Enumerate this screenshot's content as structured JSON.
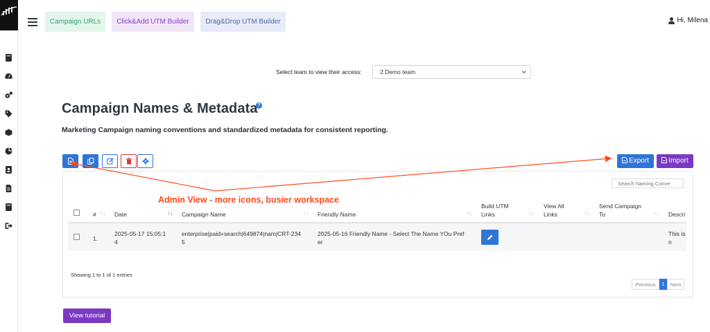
{
  "topbar": {
    "tabs": [
      {
        "label": "Campaign URLs"
      },
      {
        "label": "Click&Add UTM Builder"
      },
      {
        "label": "Drag&Drop UTM Builder"
      }
    ],
    "user_greeting": "Hi, Milena"
  },
  "sidebar": {
    "icons": [
      "book-icon",
      "dashboard-icon",
      "cogs-icon",
      "tag-icon",
      "cube-icon",
      "pie-chart-icon",
      "contact-icon",
      "file-icon",
      "book-icon",
      "logout-icon"
    ]
  },
  "team_select": {
    "label": "Select team to view their access:",
    "value": "2.Demo team"
  },
  "page": {
    "title": "Campaign Names & Metadata",
    "help": "?",
    "subtitle": "Marketing Campaign naming conventions and standardized metadata for consistent reporting."
  },
  "toolbar": {
    "export_label": "Export",
    "import_label": "Import"
  },
  "annotation": {
    "text": "Admin View - more icons, busier workspace",
    "color": "#ff4a1c"
  },
  "table": {
    "search_placeholder": "Search Naming Conve",
    "columns": {
      "num": "#",
      "date": "Date",
      "campaign_name": "Campaign Name",
      "friendly_name": "Friendly Name",
      "build_utm_1": "Build UTM",
      "build_utm_2": "Links",
      "view_all_1": "View All",
      "view_all_2": "Links",
      "send_1": "Send Campaign",
      "send_2": "To",
      "description": "Descri"
    },
    "rows": [
      {
        "num": "1.",
        "date_1": "2025-05-17 15:05:1",
        "date_2": "4",
        "campaign_1": "enterprise|paid+search|649874|nam|CRT-234",
        "campaign_2": "5",
        "friendly_1": "2025-05-16 Friendly Name - Select The Name YOu Pref",
        "friendly_2": "er",
        "description_1": "This is",
        "description_2": "n"
      }
    ],
    "showing": "Showing 1 to 1 of 1 entries",
    "pagination": {
      "previous": "Previous",
      "current": "1",
      "next": "Next"
    }
  },
  "footer": {
    "tutorial_label": "View tutorial"
  },
  "colors": {
    "primary": "#2f75d8",
    "purple": "#7b39c3",
    "danger": "#d63a3a"
  }
}
